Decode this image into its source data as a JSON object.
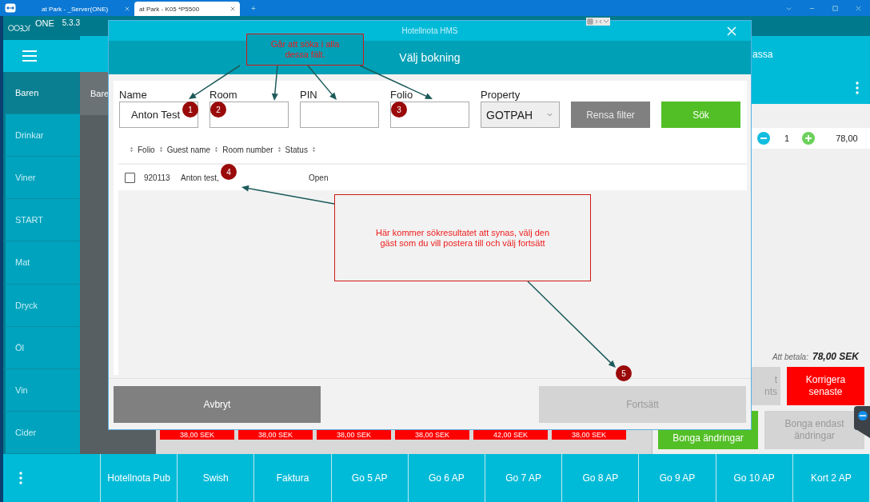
{
  "browser": {
    "tabs": [
      {
        "label": "at Park - _Server(ONE)",
        "selected": false
      },
      {
        "label": "at Park - K05 *P5500",
        "selected": true
      }
    ],
    "new_tab": "+"
  },
  "app": {
    "logo_text": "ONE",
    "version": "5.3.3",
    "categories": [
      {
        "label": "Baren",
        "selected": true
      },
      {
        "label": "Drinkar",
        "selected": false
      },
      {
        "label": "Viner",
        "selected": false
      },
      {
        "label": "START",
        "selected": false
      },
      {
        "label": "Mat",
        "selected": false
      },
      {
        "label": "Dryck",
        "selected": false
      },
      {
        "label": "Öl",
        "selected": false
      },
      {
        "label": "Vin",
        "selected": false
      },
      {
        "label": "Cider",
        "selected": false
      }
    ],
    "sub_tab": "Bare",
    "header_text": "assa",
    "order_line": {
      "quantity": "1",
      "price": "78,00"
    },
    "total_label": "Att betala:",
    "total_value": "78,00 SEK",
    "action_buttons": [
      {
        "lines": [
          "t",
          "nts"
        ],
        "kind": "grey"
      },
      {
        "lines": [
          "Korrigera",
          "senaste"
        ],
        "kind": "red"
      },
      {
        "lines": [
          "Bonga ändringar"
        ],
        "kind": "green"
      },
      {
        "lines": [
          "Bonga endast",
          "ändringar"
        ],
        "kind": "grey"
      }
    ],
    "price_tags": [
      "38,00 SEK",
      "38,00 SEK",
      "38,00 SEK",
      "38,00 SEK",
      "42,00 SEK",
      "38,00 SEK"
    ],
    "bottom_bar": [
      "Hotellnota Pub",
      "Swish",
      "Faktura",
      "Go 5 AP",
      "Go 6 AP",
      "Go 7 AP",
      "Go 8 AP",
      "Go 9 AP",
      "Go 10 AP",
      "Kort 2 AP"
    ]
  },
  "dialog": {
    "title": "Hotellnota HMS",
    "subtitle": "Välj bokning",
    "filters": [
      {
        "label": "Name",
        "value": "Anton Test",
        "kind": "text"
      },
      {
        "label": "Room",
        "kind": "text"
      },
      {
        "label": "PIN",
        "kind": "text"
      },
      {
        "label": "Folio",
        "kind": "text"
      },
      {
        "label": "Property",
        "value": "GOTPAH",
        "kind": "select"
      }
    ],
    "clear_button": "Rensa filter",
    "search_button": "Sök",
    "columns": [
      "Folio",
      "Guest name",
      "Room number",
      "Status"
    ],
    "rows": [
      {
        "checked": false,
        "folio": "920113",
        "guest_name": "Anton test,",
        "status": "Open"
      }
    ],
    "cancel_button": "Avbryt",
    "continue_button": {
      "label": "Fortsätt",
      "disabled": true
    }
  },
  "annotations": {
    "notes": [
      "Går att söka i alla dessa fält.",
      "Här kommer sökresultatet att synas, välj den gäst som du vill postera till och välj fortsätt"
    ],
    "markers": [
      "1",
      "2",
      "3",
      "4",
      "5"
    ]
  }
}
